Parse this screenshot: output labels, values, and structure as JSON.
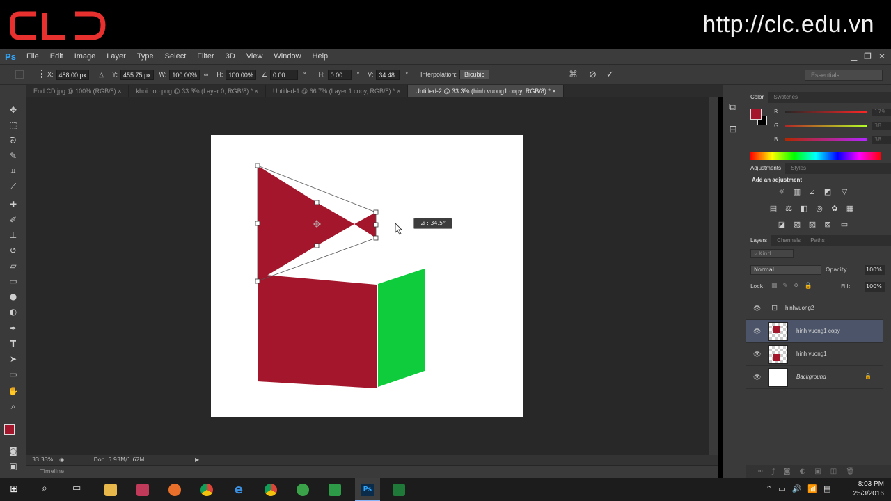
{
  "banner": {
    "logo_text": "CLD",
    "url": "http://clc.edu.vn"
  },
  "menubar": {
    "app_badge": "Ps",
    "items": [
      "File",
      "Edit",
      "Image",
      "Layer",
      "Type",
      "Select",
      "Filter",
      "3D",
      "View",
      "Window",
      "Help"
    ]
  },
  "options": {
    "x_label": "X:",
    "x_value": "488.00 px",
    "y_label": "Y:",
    "y_value": "455.75 px",
    "w_label": "W:",
    "w_value": "100.00%",
    "h_label": "H:",
    "h_value": "100.00%",
    "angle_value": "0.00",
    "hskew_label": "H:",
    "hskew_value": "0.00",
    "vskew_label": "V:",
    "vskew_value": "34.48",
    "degree": "°",
    "interp_label": "Interpolation:",
    "interp_value": "Bicubic",
    "workspace": "Essentials"
  },
  "tabs": [
    {
      "label": "End CD.jpg @ 100% (RGB/8)",
      "active": false
    },
    {
      "label": "khoi hop.png @ 33.3% (Layer 0, RGB/8) *",
      "active": false
    },
    {
      "label": "Untitled-1 @ 66.7% (Layer 1 copy, RGB/8) *",
      "active": false
    },
    {
      "label": "Untitled-2 @ 33.3% (hinh vuong1 copy, RGB/8) *",
      "active": true
    }
  ],
  "canvas": {
    "angle_readout": "⊿ : 34.5°",
    "colors": {
      "red": "#a3162b",
      "green": "#0ecc3c",
      "canvas_bg": "#ffffff"
    }
  },
  "status": {
    "zoom": "33.33%",
    "doc": "Doc: 5.93M/1.62M",
    "timeline": "Timeline"
  },
  "color_panel": {
    "tabs": [
      "Color",
      "Swatches"
    ],
    "channels": [
      {
        "label": "R",
        "value": "179"
      },
      {
        "label": "G",
        "value": "38"
      },
      {
        "label": "B",
        "value": "38"
      }
    ],
    "foreground": "#a3162b",
    "background": "#000000"
  },
  "adjust_panel": {
    "tabs": [
      "Adjustments",
      "Styles"
    ],
    "heading": "Add an adjustment"
  },
  "layers_panel": {
    "tabs": [
      "Layers",
      "Channels",
      "Paths"
    ],
    "filter": "Kind",
    "blend_mode": "Normal",
    "opacity_label": "Opacity:",
    "opacity_value": "100%",
    "lock_label": "Lock:",
    "fill_label": "Fill:",
    "fill_value": "100%",
    "layers": [
      {
        "name": "hinhvuong2",
        "selected": false
      },
      {
        "name": "hinh vuong1 copy",
        "selected": true
      },
      {
        "name": "hinh vuong1",
        "selected": false
      },
      {
        "name": "Background",
        "selected": false
      }
    ]
  },
  "taskbar": {
    "time": "8:03 PM",
    "date": "25/3/2016"
  }
}
